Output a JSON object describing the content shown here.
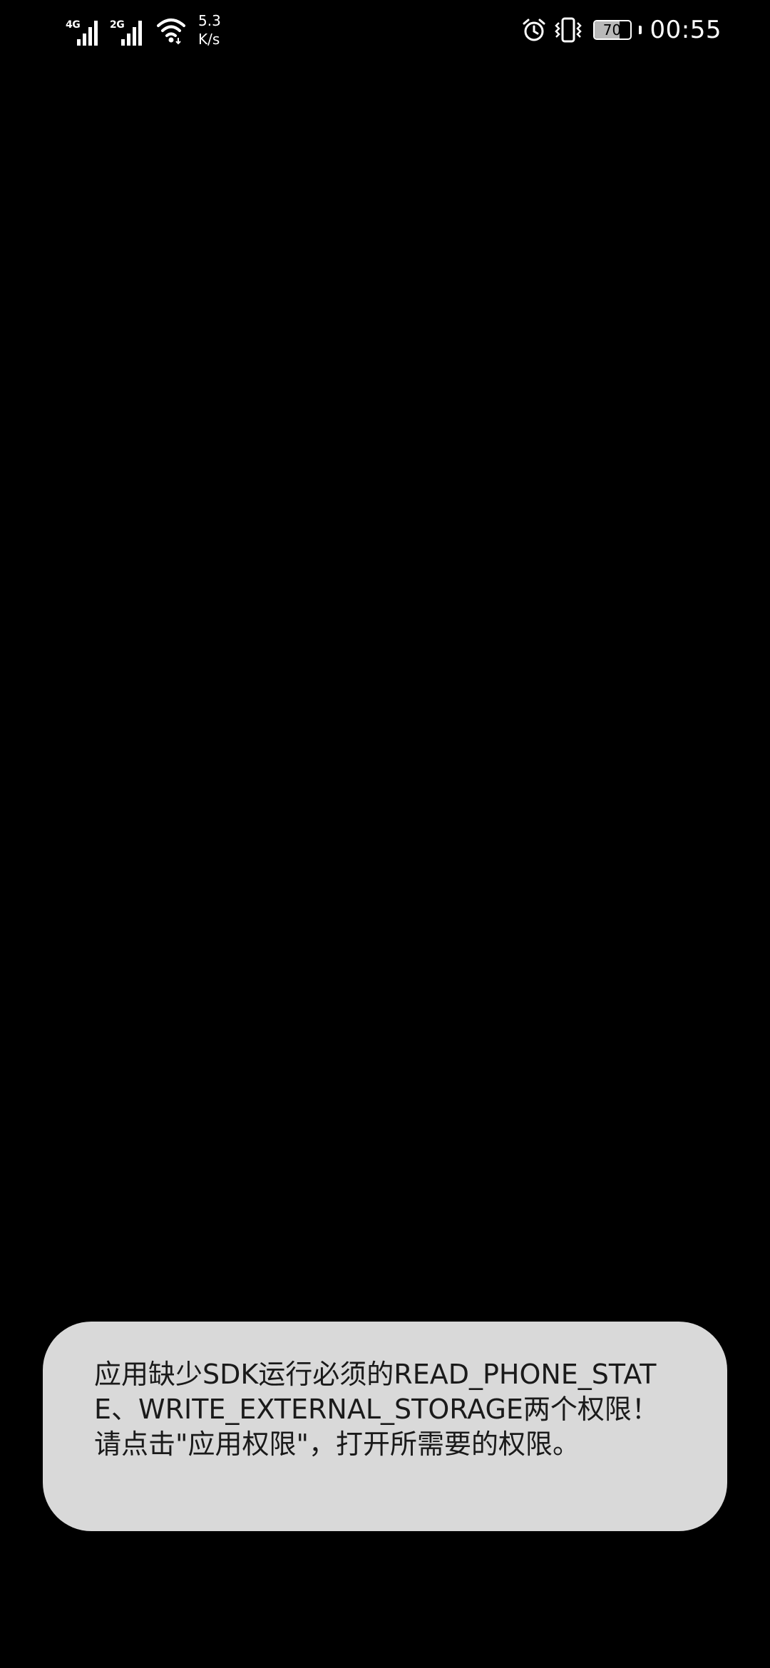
{
  "status_bar": {
    "signal_1": {
      "network_type": "4G",
      "bars": 4
    },
    "signal_2": {
      "network_type": "2G",
      "bars": 4
    },
    "net_speed_value": "5.3",
    "net_speed_unit": "K/s",
    "icons": [
      "alarm-icon",
      "vibrate-icon"
    ],
    "battery_level": "70",
    "battery_fraction": 0.7,
    "time": "00:55"
  },
  "toast": {
    "message": "应用缺少SDK运行必须的READ_PHONE_STATE、WRITE_EXTERNAL_STORAGE两个权限！请点击\"应用权限\"，打开所需要的权限。"
  },
  "colors": {
    "background": "#000000",
    "toast_background": "#d9d9d9",
    "toast_text": "#1a1a1a"
  }
}
